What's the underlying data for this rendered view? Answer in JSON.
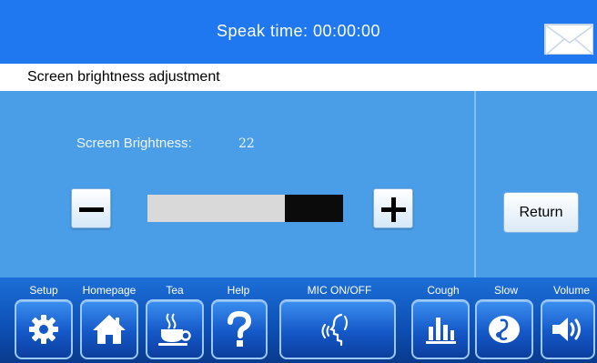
{
  "header": {
    "speak_time": "Speak time: 00:00:00",
    "mail_icon": "envelope-icon"
  },
  "section_title": "Screen brightness adjustment",
  "brightness": {
    "label": "Screen Brightness:",
    "value": "22",
    "level_fraction": 0.3
  },
  "controls": {
    "decrease_icon": "minus-icon",
    "increase_icon": "plus-icon",
    "return_label": "Return"
  },
  "nav": [
    {
      "label": "Setup",
      "icon": "gear-icon"
    },
    {
      "label": "Homepage",
      "icon": "home-icon"
    },
    {
      "label": "Tea",
      "icon": "tea-cup-icon"
    },
    {
      "label": "Help",
      "icon": "question-icon"
    },
    {
      "label": "MIC ON/OFF",
      "icon": "speaking-head-icon"
    },
    {
      "label": "Cough",
      "icon": "bar-chart-icon"
    },
    {
      "label": "Slow",
      "icon": "slow-music-icon"
    },
    {
      "label": "Volume",
      "icon": "speaker-icon"
    }
  ],
  "colors": {
    "header": "#1f78f0",
    "panel": "#4a9ee8",
    "nav": "#1458c8"
  }
}
